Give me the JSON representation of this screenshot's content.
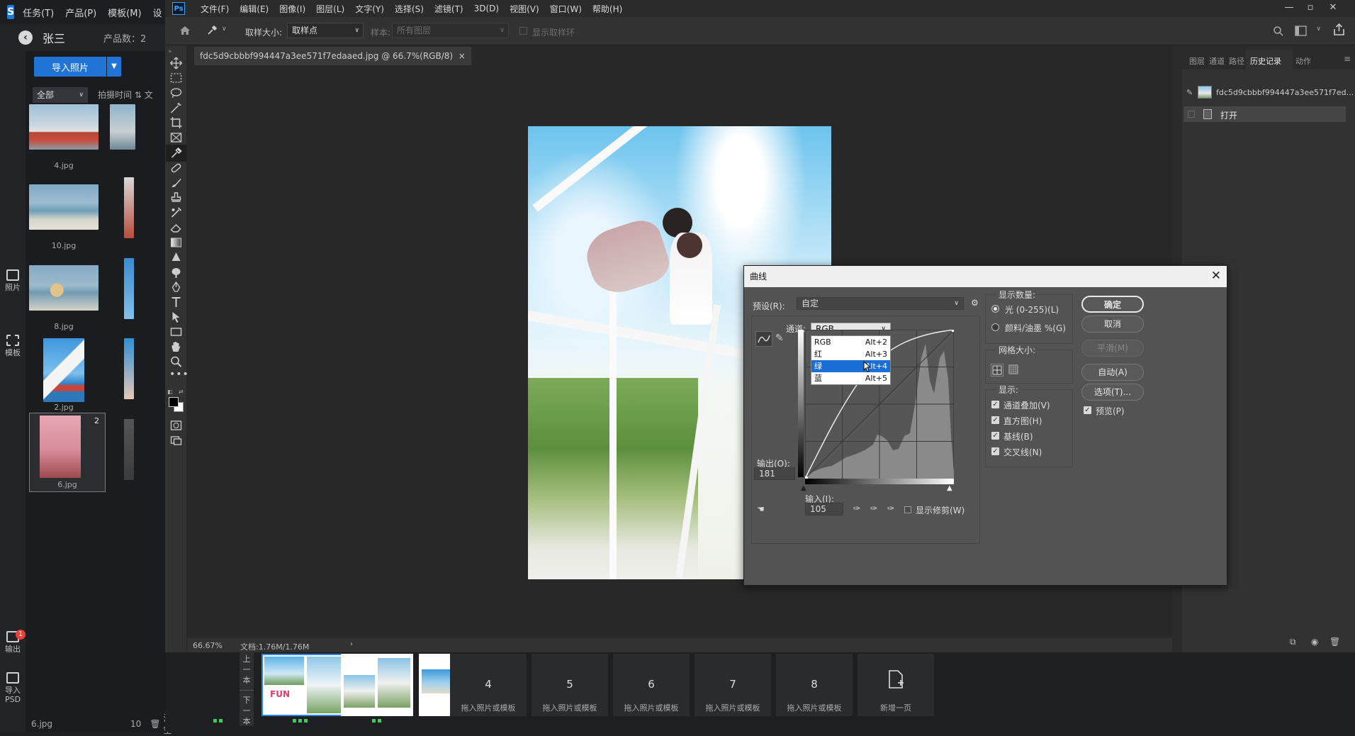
{
  "app": {
    "logo": "S",
    "menu": [
      "任务(T)",
      "产品(P)",
      "模板(M)",
      "设"
    ],
    "user": "张三",
    "product_count": "产品数：2",
    "import_button": "导入照片",
    "filter": "全部",
    "sort": "拍摄时间",
    "sort_extra": "文",
    "rail": {
      "photos": "照片",
      "templates": "模板",
      "output": "输出",
      "output_badge": "1",
      "import_psd": "导入PSD"
    },
    "thumbnails": [
      "4.jpg",
      "10.jpg",
      "8.jpg",
      "2.jpg",
      "6.jpg"
    ],
    "selected_count": "2",
    "status": {
      "file": "6.jpg",
      "count": "10",
      "clear": "清空"
    }
  },
  "ps": {
    "logo": "Ps",
    "menu": [
      "文件(F)",
      "编辑(E)",
      "图像(I)",
      "图层(L)",
      "文字(Y)",
      "选择(S)",
      "滤镜(T)",
      "3D(D)",
      "视图(V)",
      "窗口(W)",
      "帮助(H)"
    ],
    "options": {
      "sample_size_label": "取样大小:",
      "sample_size_value": "取样点",
      "sample_label": "样本:",
      "sample_value": "所有图层",
      "show_ring": "显示取样环"
    },
    "doc_tab": "fdc5d9cbbbf994447a3ee571f7edaaed.jpg @ 66.7%(RGB/8)",
    "doc_tab_close": "×",
    "zoom": "66.67%",
    "doc_size": "文档:1.76M/1.76M",
    "panel_tabs": [
      "图层",
      "通道",
      "路径",
      "历史记录",
      "动作"
    ],
    "history_snapshot": "fdc5d9cbbbf994447a3ee571f7ed...",
    "history_open": "打开"
  },
  "curves": {
    "title": "曲线",
    "preset_label": "预设(R):",
    "preset_value": "自定",
    "channel_label": "通道:",
    "channel_value": "RGB",
    "channel_options": [
      {
        "name": "RGB",
        "key": "Alt+2"
      },
      {
        "name": "红",
        "key": "Alt+3"
      },
      {
        "name": "绿",
        "key": "Alt+4"
      },
      {
        "name": "蓝",
        "key": "Alt+5"
      }
    ],
    "output_label": "输出(O):",
    "output_value": "181",
    "input_label": "输入(I):",
    "input_value": "105",
    "show_clipping": "显示修剪(W)",
    "display_amount_title": "显示数量:",
    "light": "光 (0-255)(L)",
    "pigment": "颜料/油墨 %(G)",
    "grid_size_title": "网格大小:",
    "show_title": "显示:",
    "show_options": [
      "通道叠加(V)",
      "直方图(H)",
      "基线(B)",
      "交叉线(N)"
    ],
    "buttons": {
      "ok": "确定",
      "cancel": "取消",
      "smooth": "平滑(M)",
      "auto": "自动(A)",
      "options": "选项(T)..."
    },
    "preview": "预览(P)"
  },
  "filmstrip": {
    "nav": {
      "prev": "上一本",
      "next": "下一本"
    },
    "pages": [
      {
        "num": "4",
        "label": "拖入照片或模板"
      },
      {
        "num": "5",
        "label": "拖入照片或模板"
      },
      {
        "num": "6",
        "label": "拖入照片或模板"
      },
      {
        "num": "7",
        "label": "拖入照片或模板"
      },
      {
        "num": "8",
        "label": "拖入照片或模板"
      }
    ],
    "add_page": "新增一页",
    "page1_text": "FUN"
  }
}
